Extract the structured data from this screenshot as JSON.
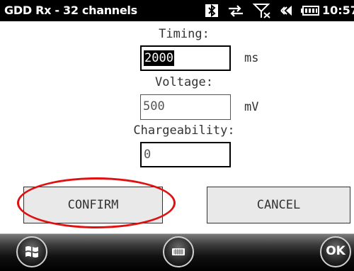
{
  "titlebar": {
    "app_title": "GDD Rx - 32 channels",
    "clock": "10:57",
    "icons": [
      "bluetooth-icon",
      "sync-arrows-icon",
      "no-signal-icon",
      "speaker-icon",
      "battery-icon"
    ]
  },
  "form": {
    "timing": {
      "label": "Timing:",
      "value": "2000",
      "unit": "ms"
    },
    "voltage": {
      "label": "Voltage:",
      "value": "500",
      "unit": "mV"
    },
    "chargeability": {
      "label": "Chargeability:",
      "value": "0"
    }
  },
  "buttons": {
    "confirm": "CONFIRM",
    "cancel": "CANCEL"
  },
  "taskbar": {
    "ok_label": "OK",
    "icons": [
      "windows-start-icon",
      "keyboard-icon",
      "ok-icon"
    ]
  },
  "colors": {
    "highlight": "#e01010",
    "titlebar": "#000000"
  }
}
